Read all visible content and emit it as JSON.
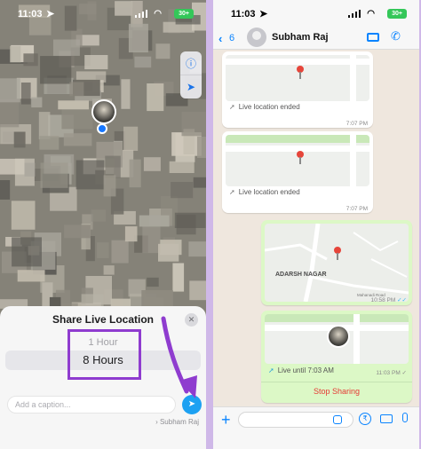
{
  "colors": {
    "divider": "#cfb8e8",
    "ios_blue": "#0a84ff",
    "send_blue": "#1da1f2",
    "highlight_purple": "#8f3ccf",
    "stop_red": "#e53935",
    "outgoing_bubble": "#dcf8c6",
    "battery_green": "#34c759"
  },
  "left_screen": {
    "status": {
      "time": "11:03",
      "battery": "30+"
    },
    "map_controls": {
      "info_icon": "info-icon",
      "locate_icon": "location-arrow-icon"
    },
    "share_sheet": {
      "title": "Share Live Location",
      "close_icon": "close-icon",
      "duration_options": [
        "1 Hour",
        "8 Hours"
      ],
      "selected_duration": "8 Hours",
      "caption_placeholder": "Add a caption...",
      "recipient": "Subham Raj",
      "send_icon": "send-icon"
    }
  },
  "right_screen": {
    "status": {
      "time": "11:03",
      "battery": "30+"
    },
    "header": {
      "back_count": "6",
      "contact_name": "Subham Raj"
    },
    "messages": [
      {
        "type": "incoming",
        "status": "Live location ended",
        "time": "7:07 PM"
      },
      {
        "type": "incoming",
        "status": "Live location ended",
        "time": "7:07 PM"
      },
      {
        "type": "outgoing",
        "place_label": "ADARSH NAGAR",
        "road_label": "Mahanadi Road",
        "time": "10:58 PM"
      },
      {
        "type": "outgoing",
        "status": "Live until 7:03 AM",
        "time": "11:03 PM",
        "action": "Stop Sharing"
      }
    ]
  }
}
